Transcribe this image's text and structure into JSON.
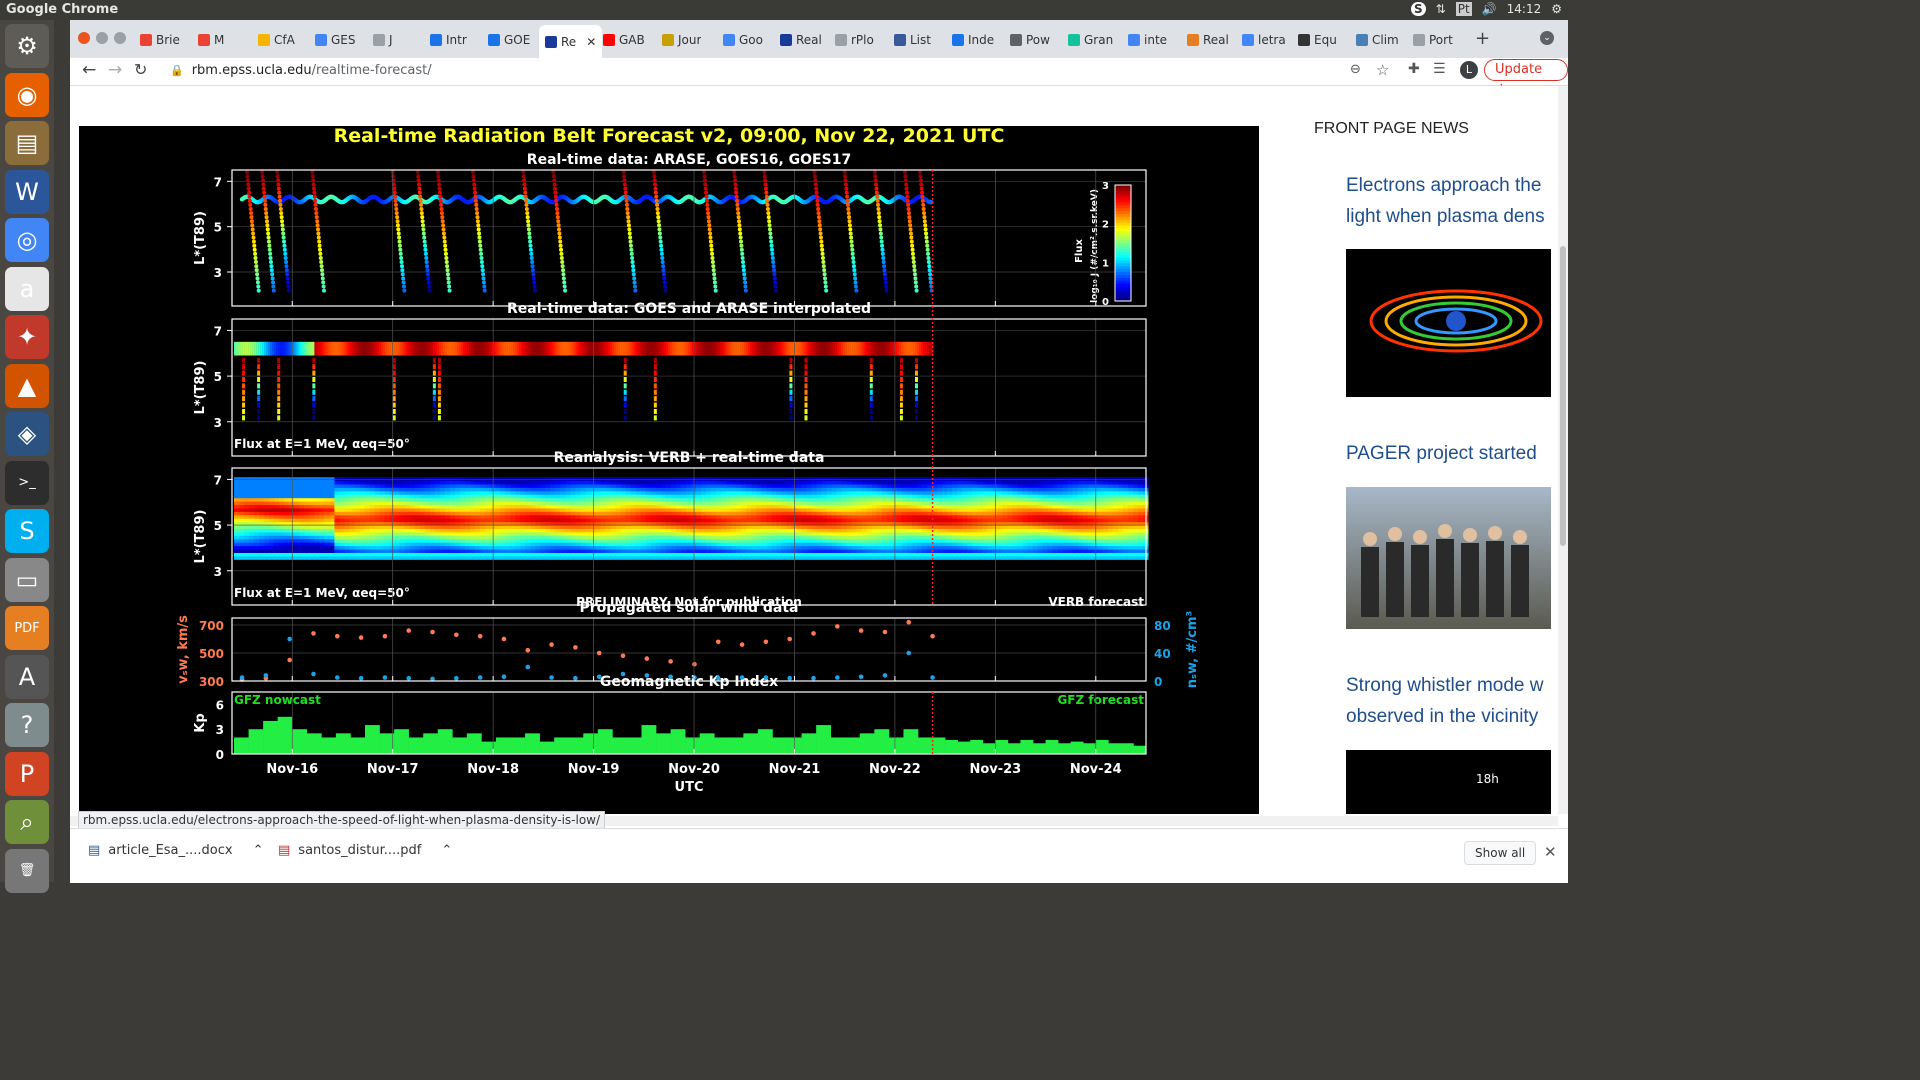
{
  "os": {
    "window_title": "Google Chrome",
    "tray": {
      "time": "14:12",
      "skype": "S",
      "lang": "Pt"
    }
  },
  "launcher": [
    {
      "name": "settings-icon",
      "glyph": "⚙",
      "color": "#5e5c57"
    },
    {
      "name": "firefox-icon",
      "glyph": "◉",
      "color": "#e66000"
    },
    {
      "name": "files-icon",
      "glyph": "▤",
      "color": "#8a6d3b"
    },
    {
      "name": "word-icon",
      "glyph": "W",
      "color": "#2b579a"
    },
    {
      "name": "chrome-icon",
      "glyph": "◎",
      "color": "#4285f4"
    },
    {
      "name": "amazon-icon",
      "glyph": "a",
      "color": "#e6e6e6"
    },
    {
      "name": "system-settings-icon",
      "glyph": "✦",
      "color": "#c0392b"
    },
    {
      "name": "matlab-icon",
      "glyph": "▲",
      "color": "#d35400"
    },
    {
      "name": "globe-icon",
      "glyph": "◈",
      "color": "#2c5282"
    },
    {
      "name": "terminal-icon",
      "glyph": ">_",
      "color": "#2d2d2d"
    },
    {
      "name": "skype-icon",
      "glyph": "S",
      "color": "#00aff0"
    },
    {
      "name": "scanner-icon",
      "glyph": "▭",
      "color": "#888888"
    },
    {
      "name": "pdf-icon",
      "glyph": "PDF",
      "color": "#e67e22"
    },
    {
      "name": "software-center-icon",
      "glyph": "A",
      "color": "#555555"
    },
    {
      "name": "help-icon",
      "glyph": "?",
      "color": "#7f8c8d"
    },
    {
      "name": "impress-icon",
      "glyph": "P",
      "color": "#d04423"
    },
    {
      "name": "image-viewer-icon",
      "glyph": "⌕",
      "color": "#6f8f3a"
    },
    {
      "name": "trash-icon",
      "glyph": "🗑",
      "color": "#777777"
    }
  ],
  "browser": {
    "tabs": [
      {
        "label": "Brie",
        "color": "#ea4335"
      },
      {
        "label": "M",
        "color": "#ea4335"
      },
      {
        "label": "CfA",
        "color": "#f4b400"
      },
      {
        "label": "GES",
        "color": "#4285f4"
      },
      {
        "label": "J",
        "color": "#9aa0a6"
      },
      {
        "label": "Intr",
        "color": "#1a73e8"
      },
      {
        "label": "GOE",
        "color": "#1a73e8"
      },
      {
        "label": "Re",
        "color": "#1a3a9a",
        "active": true
      },
      {
        "label": "GAB",
        "color": "#ff0000"
      },
      {
        "label": "Jour",
        "color": "#c5a000"
      },
      {
        "label": "Goo",
        "color": "#4285f4"
      },
      {
        "label": "Real",
        "color": "#1a3a9a"
      },
      {
        "label": "rPlo",
        "color": "#9aa0a6"
      },
      {
        "label": "List",
        "color": "#3b5998"
      },
      {
        "label": "Inde",
        "color": "#1a73e8"
      },
      {
        "label": "Pow",
        "color": "#5f6368"
      },
      {
        "label": "Gran",
        "color": "#15c39a"
      },
      {
        "label": "inte",
        "color": "#4285f4"
      },
      {
        "label": "Real",
        "color": "#e67e22"
      },
      {
        "label": "letra",
        "color": "#4285f4"
      },
      {
        "label": "Equ",
        "color": "#333333"
      },
      {
        "label": "Clim",
        "color": "#4a7fb5"
      },
      {
        "label": "Port",
        "color": "#9aa0a6"
      }
    ],
    "url_host": "rbm.epss.ucla.edu",
    "url_path": "/realtime-forecast/",
    "update_label": "Update",
    "profile_initial": "L",
    "status_url": "rbm.epss.ucla.edu/electrons-approach-the-speed-of-light-when-plasma-density-is-low/"
  },
  "figure": {
    "main_title": "Real-time Radiation Belt Forecast v2, 09:00, Nov 22, 2021 UTC",
    "panel1_title": "Real-time data: ARASE, GOES16, GOES17",
    "panel2_title": "Real-time data: GOES and ARASE interpolated",
    "panel3_title": "Reanalysis: VERB + real-time data",
    "panel4_title": "Propagated solar wind data",
    "panel5_title": "Geomagnetic Kp Index",
    "ylabel_lstar": "L*(T89)",
    "colorbar_label": "Flux",
    "colorbar_unit": "log₁₀ J (#/cm².s.sr.keV)",
    "flux_note": "Flux at E=1 MeV, αeq=50°",
    "preliminary": "PRELIMINARY. Not for publication",
    "verb_forecast": "VERB forecast",
    "vsw_label": "vₛw, km/s",
    "nsw_label": "nₛw, #/cm³",
    "kp_label": "Kp",
    "gfz_nowcast": "GFZ nowcast",
    "gfz_forecast": "GFZ forecast",
    "xlabel": "UTC",
    "now_line_color": "#ff2020",
    "accent_title": "#ffff33",
    "green_label": "#22dd22"
  },
  "chart_data": {
    "type": "multi-panel time series",
    "x_categories": [
      "Nov-16",
      "Nov-17",
      "Nov-18",
      "Nov-19",
      "Nov-20",
      "Nov-21",
      "Nov-22",
      "Nov-23",
      "Nov-24"
    ],
    "lstar_ticks": [
      3,
      5,
      7
    ],
    "colorbar_ticks": [
      0,
      1,
      2,
      3
    ],
    "vsw_ticks": [
      300,
      500,
      700
    ],
    "nsw_ticks": [
      0,
      40,
      80
    ],
    "kp_ticks": [
      0,
      3,
      6
    ],
    "now_day": 22.375,
    "vsw": [
      310,
      320,
      450,
      640,
      620,
      610,
      620,
      660,
      650,
      630,
      620,
      600,
      520,
      560,
      540,
      500,
      480,
      460,
      440,
      420,
      580,
      560,
      580,
      600,
      640,
      690,
      660,
      650,
      720,
      620
    ],
    "nsw": [
      5,
      8,
      60,
      10,
      5,
      4,
      5,
      4,
      3,
      4,
      5,
      6,
      20,
      5,
      4,
      6,
      10,
      8,
      6,
      5,
      4,
      5,
      5,
      4,
      4,
      5,
      6,
      8,
      40,
      5
    ],
    "kp_nowcast": [
      2,
      3,
      4,
      4.5,
      3,
      2.5,
      2,
      2.5,
      2,
      3.5,
      2.5,
      3,
      2,
      2.5,
      3,
      2,
      2.5,
      1.5,
      2,
      2,
      2.5,
      1.5,
      2,
      2,
      2.5,
      3,
      2,
      2,
      3.5,
      2.5,
      3,
      2,
      2.5,
      2,
      2,
      2.5,
      3,
      2,
      2,
      2.5,
      3.5,
      2,
      2,
      2.5,
      3,
      2,
      3,
      2
    ],
    "kp_forecast": [
      2,
      1.7,
      1.5,
      1.7,
      1.3,
      1.7,
      1.3,
      1.7,
      1.3,
      1.7,
      1.3,
      1.5,
      1.3,
      1.7,
      1.3,
      1.3,
      1.0
    ]
  },
  "sidebar": {
    "heading": "FRONT PAGE NEWS",
    "items": [
      {
        "line1": "Electrons approach the",
        "line2": "light when plasma dens"
      },
      {
        "line1": "PAGER project started",
        "line2": ""
      },
      {
        "line1": "Strong whistler mode w",
        "line2": "observed in the vicinity"
      }
    ],
    "clock_label": "18h"
  },
  "downloads": {
    "file1": "article_Esa_....docx",
    "file2": "santos_distur....pdf",
    "show_all": "Show all"
  }
}
